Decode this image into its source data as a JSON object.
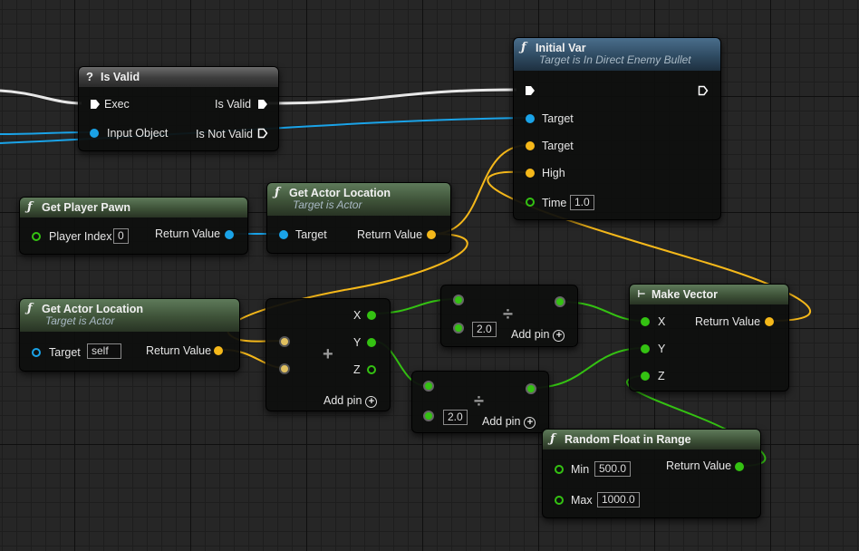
{
  "nodes": {
    "is_valid": {
      "title": "Is Valid",
      "exec": "Exec",
      "input_object": "Input Object",
      "is_valid": "Is Valid",
      "is_not_valid": "Is Not Valid"
    },
    "initial_var": {
      "title": "Initial Var",
      "subtitle": "Target is In Direct Enemy Bullet",
      "target1": "Target",
      "target2": "Target",
      "high": "High",
      "time": "Time",
      "time_value": "1.0"
    },
    "get_player_pawn": {
      "title": "Get Player Pawn",
      "player_index": "Player Index",
      "player_index_value": "0",
      "return_value": "Return Value"
    },
    "get_actor_location_1": {
      "title": "Get Actor Location",
      "subtitle": "Target is Actor",
      "target": "Target",
      "return_value": "Return Value"
    },
    "get_actor_location_2": {
      "title": "Get Actor Location",
      "subtitle": "Target is Actor",
      "target": "Target",
      "target_value": "self",
      "return_value": "Return Value"
    },
    "add_vector": {
      "x": "X",
      "y": "Y",
      "z": "Z",
      "add_pin": "Add pin"
    },
    "divide_1": {
      "value": "2.0",
      "add_pin": "Add pin"
    },
    "divide_2": {
      "value": "2.0",
      "add_pin": "Add pin"
    },
    "make_vector": {
      "title": "Make Vector",
      "x": "X",
      "y": "Y",
      "z": "Z",
      "return_value": "Return Value"
    },
    "random_float": {
      "title": "Random Float in Range",
      "min": "Min",
      "min_value": "500.0",
      "max": "Max",
      "max_value": "1000.0",
      "return_value": "Return Value"
    }
  },
  "colors": {
    "exec": "#ffffff",
    "object": "#1aa3e8",
    "vector": "#f5b81a",
    "float": "#34c212",
    "background": "#262626"
  }
}
